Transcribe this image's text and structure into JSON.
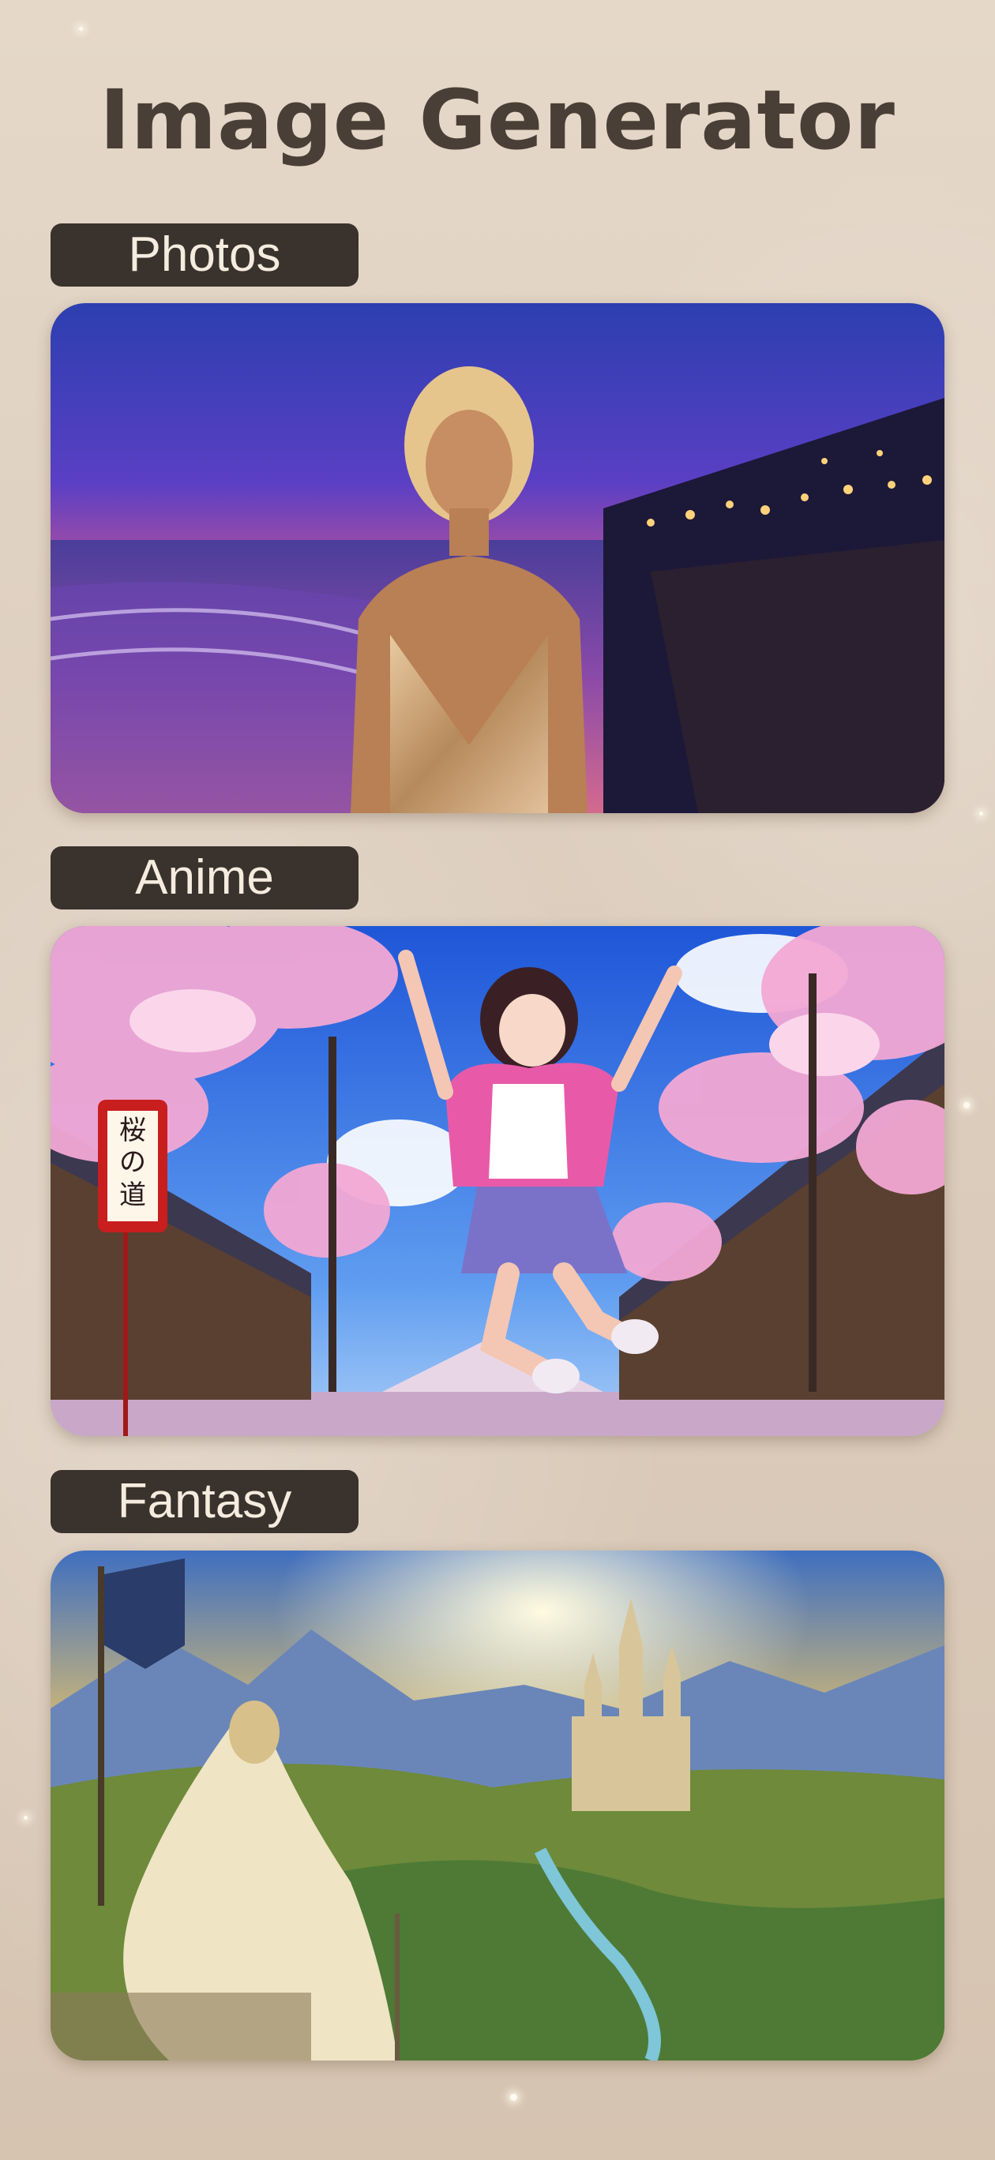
{
  "header": {
    "title": "Image Generator"
  },
  "sections": [
    {
      "label": "Photos",
      "image": "photo-beach-sunset"
    },
    {
      "label": "Anime",
      "image": "anime-cherry-blossom-street"
    },
    {
      "label": "Fantasy",
      "image": "fantasy-castle-landscape"
    }
  ],
  "sign_text": [
    "桜",
    "の",
    "道"
  ],
  "colors": {
    "label_bg": "#3a322c",
    "label_text": "#f5ecdf",
    "title": "#4a3f36"
  }
}
